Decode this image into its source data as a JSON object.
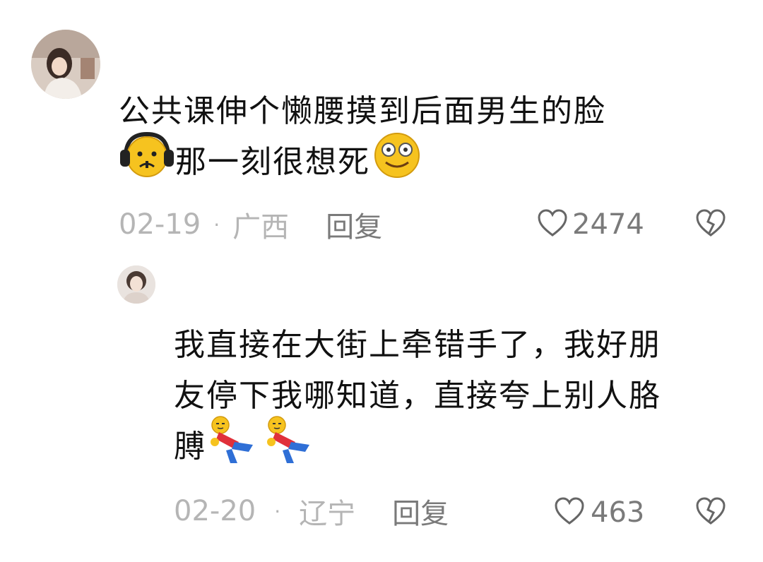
{
  "comments": [
    {
      "text_line1": "公共课伸个懒腰摸到后面男生的脸",
      "text_line2": "那一刻很想死",
      "date": "02-19",
      "dot": "·",
      "location": "广西",
      "reply_label": "回复",
      "likes": "2474",
      "icons": [
        "headphones-sad-emoji-icon",
        "dizzy-eyes-emoji-icon",
        "heart-outline-icon",
        "broken-heart-icon"
      ]
    },
    {
      "text_line1": "我直接在大街上牵错手了，我好朋",
      "text_line2": "友停下我哪知道，直接夸上别人胳",
      "text_line3": "膊",
      "date": "02-20",
      "dot": "·",
      "location": "辽宁",
      "reply_label": "回复",
      "likes": "463",
      "icons": [
        "running-doll-emoji-icon",
        "running-doll-emoji-icon",
        "heart-outline-icon",
        "broken-heart-icon"
      ]
    }
  ],
  "colors": {
    "meta_gray": "#b5b5b5",
    "reply_gray": "#7a7a7a",
    "emoji_yellow": "#f6c31f",
    "emoji_outline": "#d39b0e"
  }
}
